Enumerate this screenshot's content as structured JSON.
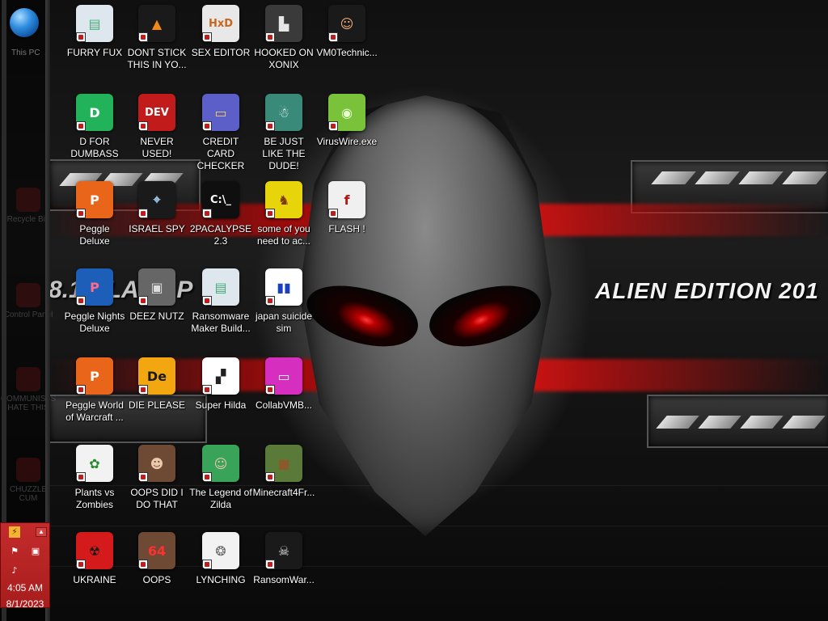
{
  "desktop": {
    "wallpaper_text": "ALIEN EDITION 201",
    "wallpaper_side_text": "8.1 BLAZE P",
    "left_column": {
      "this_pc": "This PC",
      "ghost_labels": [
        "Recycle Bin",
        "Control Panel",
        "COMMUNISTS HATE THIS",
        "CHUZZLE CUM"
      ]
    },
    "icons": [
      {
        "label": "FURRY FUX",
        "name": "furry-fux",
        "bg": "#dfe7ee",
        "glyph": "▤",
        "color": "#4a7"
      },
      {
        "label": "DONT STICK THIS IN YO...",
        "name": "dont-stick-this-in-yo",
        "bg": "#1a1a1a",
        "glyph": "▲",
        "color": "#f08a17"
      },
      {
        "label": "SEX EDITOR",
        "name": "sex-editor",
        "bg": "#e8e8e8",
        "glyph": "HxD",
        "color": "#c9661a"
      },
      {
        "label": "HOOKED ON XONIX",
        "name": "hooked-on-xonix",
        "bg": "#3a3a3a",
        "glyph": "▙",
        "color": "#e6e6e6"
      },
      {
        "label": "VM0Technic...",
        "name": "vm0technic",
        "bg": "#1a1a1a",
        "glyph": "☺",
        "color": "#f3b07a"
      },
      {
        "label": "D FOR DUMBASS",
        "name": "d-for-dumbass",
        "bg": "#22b25a",
        "glyph": "D",
        "color": "#ffffff"
      },
      {
        "label": "NEVER USED!",
        "name": "never-used",
        "bg": "#c21b1b",
        "glyph": "DEV",
        "color": "#ffffff"
      },
      {
        "label": "CREDIT CARD CHECKER",
        "name": "credit-card-checker",
        "bg": "#5b5fc7",
        "glyph": "▭",
        "color": "#f0d060"
      },
      {
        "label": "BE JUST LIKE THE DUDE!",
        "name": "be-just-like-the-dude",
        "bg": "#3a8a7a",
        "glyph": "☃",
        "color": "#ffffff"
      },
      {
        "label": "VirusWire.exe",
        "name": "viruswire-exe",
        "bg": "#79c23a",
        "glyph": "◉",
        "color": "#e9ffd0"
      },
      {
        "label": "Peggle Deluxe",
        "name": "peggle-deluxe",
        "bg": "#e8651a",
        "glyph": "P",
        "color": "#ffffff"
      },
      {
        "label": "ISRAEL SPY",
        "name": "israel-spy",
        "bg": "#1a1a1a",
        "glyph": "⌖",
        "color": "#a8d0f0"
      },
      {
        "label": "2PACALYPSE 2.3",
        "name": "2pacalypse-2-3",
        "bg": "#0f0f0f",
        "glyph": "C:\\_",
        "color": "#ffffff"
      },
      {
        "label": "some of you need to ac...",
        "name": "some-of-you-need-to-ac",
        "bg": "#e8d40a",
        "glyph": "♞",
        "color": "#7a3a12"
      },
      {
        "label": "FLASH !",
        "name": "flash",
        "bg": "#f0f0f0",
        "glyph": "f",
        "color": "#b11"
      },
      {
        "label": "Peggle Nights Deluxe",
        "name": "peggle-nights-deluxe",
        "bg": "#1d5fb8",
        "glyph": "P",
        "color": "#ff6b8a"
      },
      {
        "label": "DEEZ NUTZ",
        "name": "deez-nutz",
        "bg": "#666666",
        "glyph": "▣",
        "color": "#dddddd"
      },
      {
        "label": "Ransomware Maker Build...",
        "name": "ransomware-maker-build",
        "bg": "#dfe7ee",
        "glyph": "▤",
        "color": "#4a7"
      },
      {
        "label": "japan suicide sim",
        "name": "japan-suicide-sim",
        "bg": "#ffffff",
        "glyph": "▮▮",
        "color": "#1a3fbf"
      },
      {
        "label": "Peggle World of Warcraft ...",
        "name": "peggle-world-of-warcraft",
        "bg": "#e8651a",
        "glyph": "P",
        "color": "#ffffff"
      },
      {
        "label": "DIE PLEASE",
        "name": "die-please",
        "bg": "#f2a60f",
        "glyph": "De",
        "color": "#1a1a1a"
      },
      {
        "label": "Super Hilda",
        "name": "super-hilda",
        "bg": "#ffffff",
        "glyph": "▞",
        "color": "#222"
      },
      {
        "label": "CollabVMB...",
        "name": "collabvmb",
        "bg": "#d62fbf",
        "glyph": "▭",
        "color": "#ffffff"
      },
      {
        "label": "Plants vs Zombies",
        "name": "plants-vs-zombies",
        "bg": "#f2f2f2",
        "glyph": "✿",
        "color": "#2a8a2a"
      },
      {
        "label": "OOPS DID I DO THAT",
        "name": "oops-did-i-do-that",
        "bg": "#6e4a34",
        "glyph": "☻",
        "color": "#e9c9a9"
      },
      {
        "label": "The Legend of Zilda",
        "name": "the-legend-of-zilda",
        "bg": "#3aa35a",
        "glyph": "☺",
        "color": "#e9c9a9"
      },
      {
        "label": "Minecraft4Fr...",
        "name": "minecraft4fr",
        "bg": "#5a7a3a",
        "glyph": "■",
        "color": "#8a5a2a"
      },
      {
        "label": "UKRAINE",
        "name": "ukraine",
        "bg": "#d41a1a",
        "glyph": "☢",
        "color": "#1a1a1a"
      },
      {
        "label": "OOPS",
        "name": "oops",
        "bg": "#6e4a34",
        "glyph": "64",
        "color": "#ff3030"
      },
      {
        "label": "LYNCHING",
        "name": "lynching",
        "bg": "#f2f2f2",
        "glyph": "❂",
        "color": "#666"
      },
      {
        "label": "RansomWar...",
        "name": "ransomwar",
        "bg": "#1a1a1a",
        "glyph": "☠",
        "color": "#e0e0e0"
      }
    ]
  },
  "tray": {
    "time": "4:05 AM",
    "date": "8/1/2023",
    "icons": {
      "app": "lightning-icon",
      "flag": "action-center-flag-icon",
      "network": "network-icon",
      "volume": "volume-icon",
      "expand": "show-hidden-icons-icon"
    },
    "color": "#c42b2b"
  }
}
